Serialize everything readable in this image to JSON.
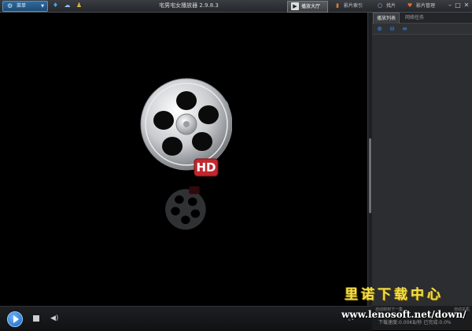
{
  "titlebar": {
    "menu_label": "菜单",
    "app_title": "宅男宅女播放器 2.9.8.3",
    "tabs": [
      {
        "label": "播放大厅",
        "icon": "play-hall-icon"
      },
      {
        "label": "影片索引",
        "icon": "film-index-icon"
      },
      {
        "label": "找片",
        "icon": "search-icon"
      },
      {
        "label": "影片管理",
        "icon": "film-manage-icon"
      }
    ]
  },
  "panel": {
    "tabs": [
      "播放列表",
      "网络任务"
    ],
    "footer_left": "自动转到下一集",
    "footer_right": "自动关机",
    "status": "下载速度:0.00KB/秒 已完成:0.0%"
  },
  "logo": {
    "badge": "HD"
  },
  "watermark": {
    "name": "里诺下载中心",
    "url": "www.lenosoft.net/down/"
  },
  "colors": {
    "accent": "#1763b8",
    "watermark_yellow": "#f2e04a",
    "badge_red": "#c2272d"
  }
}
